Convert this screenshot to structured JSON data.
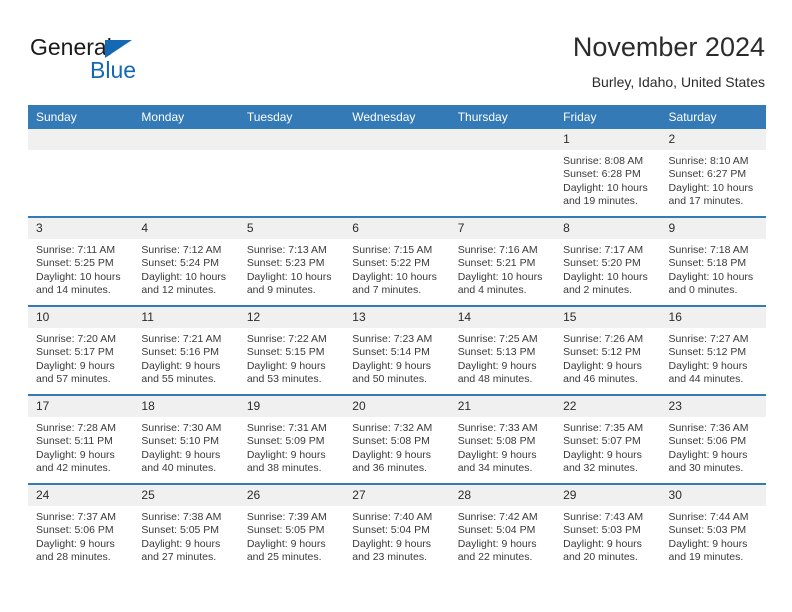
{
  "brand": {
    "name_dark": "General",
    "name_blue": "Blue",
    "accent_color": "#1569b4"
  },
  "header": {
    "title": "November 2024",
    "subtitle": "Burley, Idaho, United States"
  },
  "theme": {
    "header_row_bg": "#337ab7",
    "daynum_bg": "#f0f0f0",
    "separator": "#337ab7",
    "text": "#2b2b2b"
  },
  "labels": {
    "sunrise_prefix": "Sunrise:",
    "sunset_prefix": "Sunset:",
    "daylight_prefix": "Daylight:"
  },
  "weekday_headers": [
    "Sunday",
    "Monday",
    "Tuesday",
    "Wednesday",
    "Thursday",
    "Friday",
    "Saturday"
  ],
  "weeks": [
    [
      {
        "day": "",
        "blank": true,
        "sunrise": "",
        "sunset": "",
        "daylight": ""
      },
      {
        "day": "",
        "blank": true,
        "sunrise": "",
        "sunset": "",
        "daylight": ""
      },
      {
        "day": "",
        "blank": true,
        "sunrise": "",
        "sunset": "",
        "daylight": ""
      },
      {
        "day": "",
        "blank": true,
        "sunrise": "",
        "sunset": "",
        "daylight": ""
      },
      {
        "day": "",
        "blank": true,
        "sunrise": "",
        "sunset": "",
        "daylight": ""
      },
      {
        "day": "1",
        "blank": false,
        "sunrise": "Sunrise: 8:08 AM",
        "sunset": "Sunset: 6:28 PM",
        "daylight": "Daylight: 10 hours and 19 minutes."
      },
      {
        "day": "2",
        "blank": false,
        "sunrise": "Sunrise: 8:10 AM",
        "sunset": "Sunset: 6:27 PM",
        "daylight": "Daylight: 10 hours and 17 minutes."
      }
    ],
    [
      {
        "day": "3",
        "blank": false,
        "sunrise": "Sunrise: 7:11 AM",
        "sunset": "Sunset: 5:25 PM",
        "daylight": "Daylight: 10 hours and 14 minutes."
      },
      {
        "day": "4",
        "blank": false,
        "sunrise": "Sunrise: 7:12 AM",
        "sunset": "Sunset: 5:24 PM",
        "daylight": "Daylight: 10 hours and 12 minutes."
      },
      {
        "day": "5",
        "blank": false,
        "sunrise": "Sunrise: 7:13 AM",
        "sunset": "Sunset: 5:23 PM",
        "daylight": "Daylight: 10 hours and 9 minutes."
      },
      {
        "day": "6",
        "blank": false,
        "sunrise": "Sunrise: 7:15 AM",
        "sunset": "Sunset: 5:22 PM",
        "daylight": "Daylight: 10 hours and 7 minutes."
      },
      {
        "day": "7",
        "blank": false,
        "sunrise": "Sunrise: 7:16 AM",
        "sunset": "Sunset: 5:21 PM",
        "daylight": "Daylight: 10 hours and 4 minutes."
      },
      {
        "day": "8",
        "blank": false,
        "sunrise": "Sunrise: 7:17 AM",
        "sunset": "Sunset: 5:20 PM",
        "daylight": "Daylight: 10 hours and 2 minutes."
      },
      {
        "day": "9",
        "blank": false,
        "sunrise": "Sunrise: 7:18 AM",
        "sunset": "Sunset: 5:18 PM",
        "daylight": "Daylight: 10 hours and 0 minutes."
      }
    ],
    [
      {
        "day": "10",
        "blank": false,
        "sunrise": "Sunrise: 7:20 AM",
        "sunset": "Sunset: 5:17 PM",
        "daylight": "Daylight: 9 hours and 57 minutes."
      },
      {
        "day": "11",
        "blank": false,
        "sunrise": "Sunrise: 7:21 AM",
        "sunset": "Sunset: 5:16 PM",
        "daylight": "Daylight: 9 hours and 55 minutes."
      },
      {
        "day": "12",
        "blank": false,
        "sunrise": "Sunrise: 7:22 AM",
        "sunset": "Sunset: 5:15 PM",
        "daylight": "Daylight: 9 hours and 53 minutes."
      },
      {
        "day": "13",
        "blank": false,
        "sunrise": "Sunrise: 7:23 AM",
        "sunset": "Sunset: 5:14 PM",
        "daylight": "Daylight: 9 hours and 50 minutes."
      },
      {
        "day": "14",
        "blank": false,
        "sunrise": "Sunrise: 7:25 AM",
        "sunset": "Sunset: 5:13 PM",
        "daylight": "Daylight: 9 hours and 48 minutes."
      },
      {
        "day": "15",
        "blank": false,
        "sunrise": "Sunrise: 7:26 AM",
        "sunset": "Sunset: 5:12 PM",
        "daylight": "Daylight: 9 hours and 46 minutes."
      },
      {
        "day": "16",
        "blank": false,
        "sunrise": "Sunrise: 7:27 AM",
        "sunset": "Sunset: 5:12 PM",
        "daylight": "Daylight: 9 hours and 44 minutes."
      }
    ],
    [
      {
        "day": "17",
        "blank": false,
        "sunrise": "Sunrise: 7:28 AM",
        "sunset": "Sunset: 5:11 PM",
        "daylight": "Daylight: 9 hours and 42 minutes."
      },
      {
        "day": "18",
        "blank": false,
        "sunrise": "Sunrise: 7:30 AM",
        "sunset": "Sunset: 5:10 PM",
        "daylight": "Daylight: 9 hours and 40 minutes."
      },
      {
        "day": "19",
        "blank": false,
        "sunrise": "Sunrise: 7:31 AM",
        "sunset": "Sunset: 5:09 PM",
        "daylight": "Daylight: 9 hours and 38 minutes."
      },
      {
        "day": "20",
        "blank": false,
        "sunrise": "Sunrise: 7:32 AM",
        "sunset": "Sunset: 5:08 PM",
        "daylight": "Daylight: 9 hours and 36 minutes."
      },
      {
        "day": "21",
        "blank": false,
        "sunrise": "Sunrise: 7:33 AM",
        "sunset": "Sunset: 5:08 PM",
        "daylight": "Daylight: 9 hours and 34 minutes."
      },
      {
        "day": "22",
        "blank": false,
        "sunrise": "Sunrise: 7:35 AM",
        "sunset": "Sunset: 5:07 PM",
        "daylight": "Daylight: 9 hours and 32 minutes."
      },
      {
        "day": "23",
        "blank": false,
        "sunrise": "Sunrise: 7:36 AM",
        "sunset": "Sunset: 5:06 PM",
        "daylight": "Daylight: 9 hours and 30 minutes."
      }
    ],
    [
      {
        "day": "24",
        "blank": false,
        "sunrise": "Sunrise: 7:37 AM",
        "sunset": "Sunset: 5:06 PM",
        "daylight": "Daylight: 9 hours and 28 minutes."
      },
      {
        "day": "25",
        "blank": false,
        "sunrise": "Sunrise: 7:38 AM",
        "sunset": "Sunset: 5:05 PM",
        "daylight": "Daylight: 9 hours and 27 minutes."
      },
      {
        "day": "26",
        "blank": false,
        "sunrise": "Sunrise: 7:39 AM",
        "sunset": "Sunset: 5:05 PM",
        "daylight": "Daylight: 9 hours and 25 minutes."
      },
      {
        "day": "27",
        "blank": false,
        "sunrise": "Sunrise: 7:40 AM",
        "sunset": "Sunset: 5:04 PM",
        "daylight": "Daylight: 9 hours and 23 minutes."
      },
      {
        "day": "28",
        "blank": false,
        "sunrise": "Sunrise: 7:42 AM",
        "sunset": "Sunset: 5:04 PM",
        "daylight": "Daylight: 9 hours and 22 minutes."
      },
      {
        "day": "29",
        "blank": false,
        "sunrise": "Sunrise: 7:43 AM",
        "sunset": "Sunset: 5:03 PM",
        "daylight": "Daylight: 9 hours and 20 minutes."
      },
      {
        "day": "30",
        "blank": false,
        "sunrise": "Sunrise: 7:44 AM",
        "sunset": "Sunset: 5:03 PM",
        "daylight": "Daylight: 9 hours and 19 minutes."
      }
    ]
  ]
}
